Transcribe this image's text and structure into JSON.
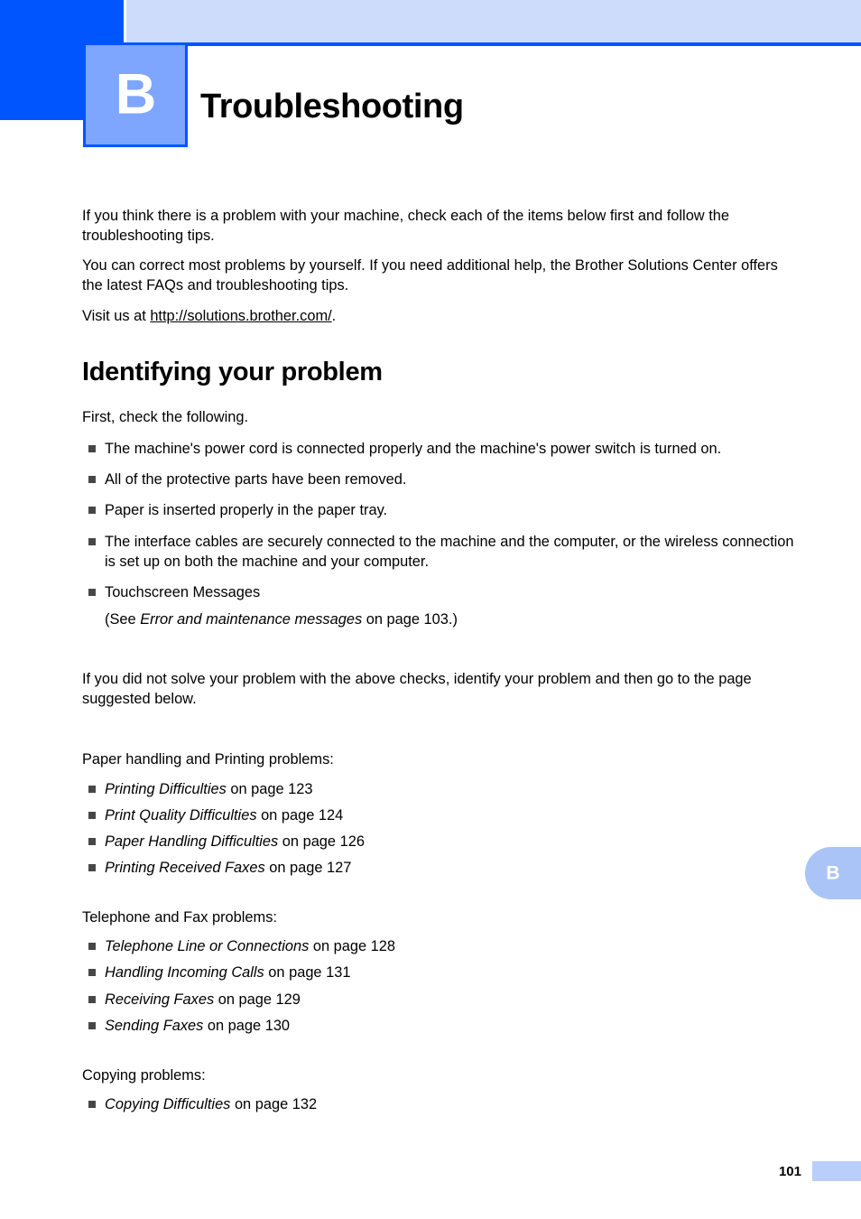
{
  "chapter": {
    "letter": "B",
    "title": "Troubleshooting",
    "edge_tab_letter": "B"
  },
  "colors": {
    "accent_blue": "#0055ff",
    "chapter_box_fill": "#7ea6ff",
    "header_band": "#cedcfb",
    "edge_tab": "#aac4f8",
    "footer_swatch": "#b9cefb",
    "bullet": "#474747"
  },
  "intro": {
    "paragraph_1": "If you think there is a problem with your machine, check each of the items below first and follow the troubleshooting tips.",
    "paragraph_2": "You can correct most problems by yourself. If you need additional help, the Brother Solutions Center offers the latest FAQs and troubleshooting tips.",
    "visit_prefix": "Visit us at ",
    "visit_link": "http://solutions.brother.com/",
    "visit_suffix": "."
  },
  "section": {
    "heading": "Identifying your problem",
    "lead": "First, check the following.",
    "checklist": [
      "The machine's power cord is connected properly and the machine's power switch is turned on.",
      "All of the protective parts have been removed.",
      "Paper is inserted properly in the paper tray.",
      "The interface cables are securely connected to the machine and the computer, or the wireless connection is set up on both the machine and your computer.",
      "Touchscreen Messages"
    ],
    "touchscreen_note": {
      "prefix": "(See ",
      "title": "Error and maintenance messages",
      "suffix": " on page 103.)"
    },
    "after_checklist_paragraph": "If you did not solve your problem with the above checks, identify your problem and then go to the page suggested below."
  },
  "groups": [
    {
      "label": "Paper handling and Printing problems:",
      "items": [
        {
          "title": "Printing Difficulties",
          "ref": " on page 123"
        },
        {
          "title": "Print Quality Difficulties",
          "ref": " on page 124"
        },
        {
          "title": "Paper Handling Difficulties",
          "ref": " on page 126"
        },
        {
          "title": "Printing Received Faxes",
          "ref": " on page 127"
        }
      ]
    },
    {
      "label": "Telephone and Fax problems:",
      "items": [
        {
          "title": "Telephone Line or Connections",
          "ref": " on page 128"
        },
        {
          "title": "Handling Incoming Calls",
          "ref": " on page 131"
        },
        {
          "title": "Receiving Faxes",
          "ref": " on page 129"
        },
        {
          "title": "Sending Faxes",
          "ref": " on page 130"
        }
      ]
    },
    {
      "label": "Copying problems:",
      "items": [
        {
          "title": "Copying Difficulties",
          "ref": " on page 132"
        }
      ]
    }
  ],
  "footer": {
    "page_number": "101"
  }
}
